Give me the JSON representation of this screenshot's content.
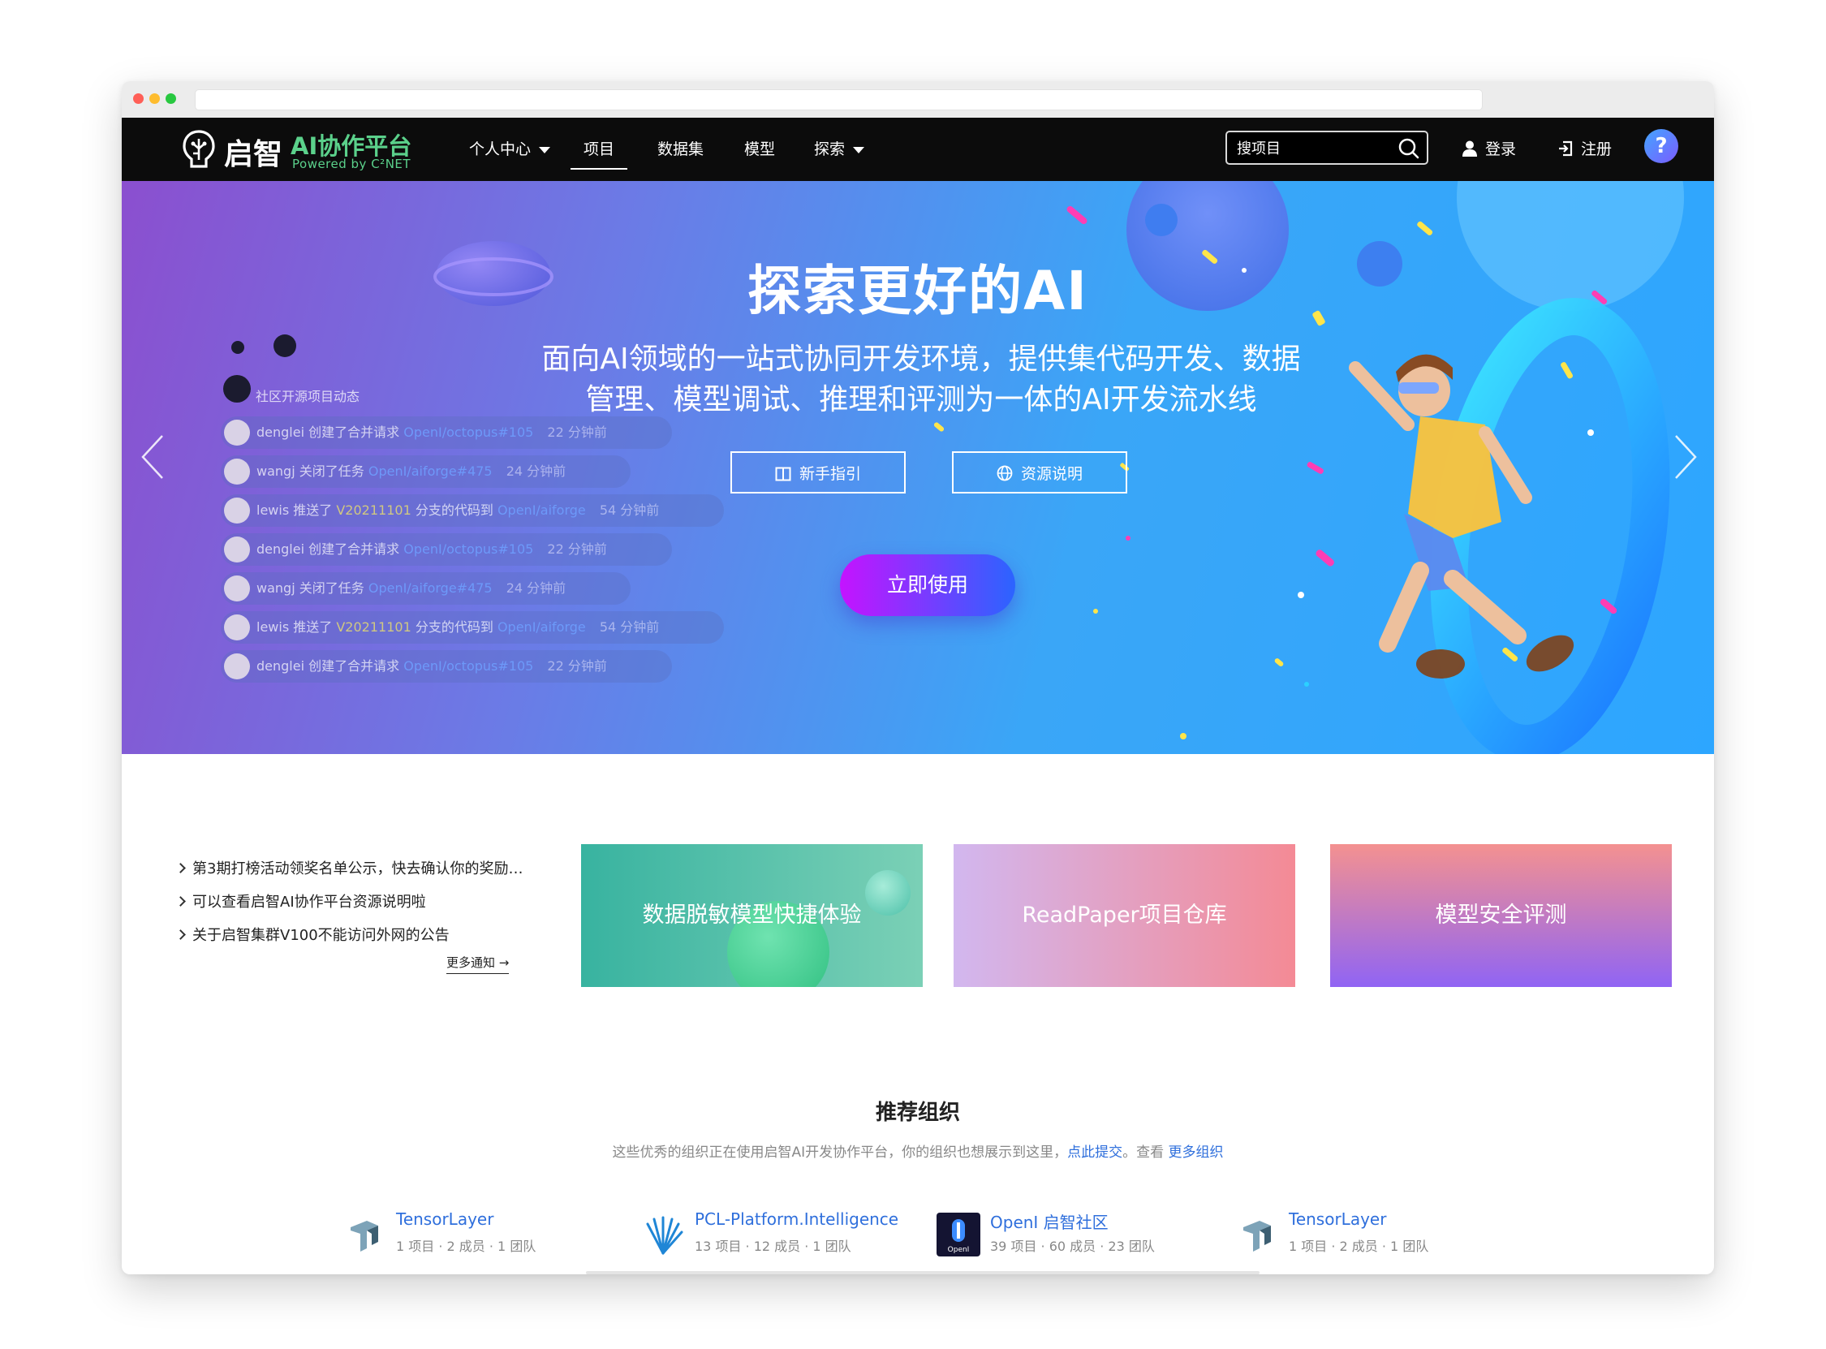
{
  "nav": {
    "logo_cn": "启智",
    "logo_title": "AI协作平台",
    "logo_sub": "Powered by C²NET",
    "items": [
      {
        "label": "个人中心",
        "dropdown": true
      },
      {
        "label": "项目",
        "active": true
      },
      {
        "label": "数据集"
      },
      {
        "label": "模型"
      },
      {
        "label": "探索",
        "dropdown": true
      }
    ],
    "search_placeholder": "搜项目",
    "login": "登录",
    "register": "注册",
    "help": "?"
  },
  "hero": {
    "title": "探索更好的AI",
    "subtitle_line1": "面向AI领域的一站式协同开发环境，提供集代码开发、数据",
    "subtitle_line2": "管理、模型调试、推理和评测为一体的AI开发流水线",
    "guide_btn": "新手指引",
    "resource_btn": "资源说明",
    "cta": "立即使用",
    "activity_title": "社区开源项目动态",
    "activities": [
      {
        "user": "denglei",
        "action": "创建了合并请求",
        "target": "OpenI/octopus#105",
        "time": "22 分钟前"
      },
      {
        "user": "wangj",
        "action": "关闭了任务",
        "target": "OpenI/aiforge#475",
        "time": "24 分钟前"
      },
      {
        "user": "lewis",
        "action": "推送了",
        "ref": "V20211101",
        "action2": "分支的代码到",
        "target": "OpenI/aiforge",
        "time": "54 分钟前"
      },
      {
        "user": "denglei",
        "action": "创建了合并请求",
        "target": "OpenI/octopus#105",
        "time": "22 分钟前"
      },
      {
        "user": "wangj",
        "action": "关闭了任务",
        "target": "OpenI/aiforge#475",
        "time": "24 分钟前"
      },
      {
        "user": "lewis",
        "action": "推送了",
        "ref": "V20211101",
        "action2": "分支的代码到",
        "target": "OpenI/aiforge",
        "time": "54 分钟前"
      },
      {
        "user": "denglei",
        "action": "创建了合并请求",
        "target": "OpenI/octopus#105",
        "time": "22 分钟前"
      }
    ]
  },
  "notices": {
    "items": [
      "第3期打榜活动领奖名单公示，快去确认你的奖励…",
      "可以查看启智AI协作平台资源说明啦",
      "关于启智集群V100不能访问外网的公告"
    ],
    "more": "更多通知 →"
  },
  "cards": [
    {
      "label": "数据脱敏模型快捷体验"
    },
    {
      "label": "ReadPaper项目仓库"
    },
    {
      "label": "模型安全评测"
    }
  ],
  "orgs": {
    "title": "推荐组织",
    "desc_prefix": "这些优秀的组织正在使用启智AI开发协作平台，你的组织也想展示到这里，",
    "submit_link": "点此提交",
    "desc_mid": "。查看 ",
    "more_link": "更多组织",
    "items": [
      {
        "name": "TensorLayer",
        "meta": "1 项目 · 2 成员 · 1 团队",
        "icon": "tensorlayer-logo"
      },
      {
        "name": "PCL-Platform.Intelligence",
        "meta": "13 项目 · 12 成员 · 1 团队",
        "icon": "pcl-logo"
      },
      {
        "name": "OpenI 启智社区",
        "meta": "39 项目 · 60 成员 · 23 团队",
        "icon": "openi-logo"
      },
      {
        "name": "TensorLayer",
        "meta": "1 项目 · 2 成员 · 1 团队",
        "icon": "tensorlayer-logo"
      }
    ]
  },
  "colors": {
    "nav_bg": "#0c0c0c",
    "brand_green": "#5bd18b",
    "link_blue": "#2f6fdc",
    "cta_start": "#c513ff",
    "cta_end": "#2b64ff"
  }
}
